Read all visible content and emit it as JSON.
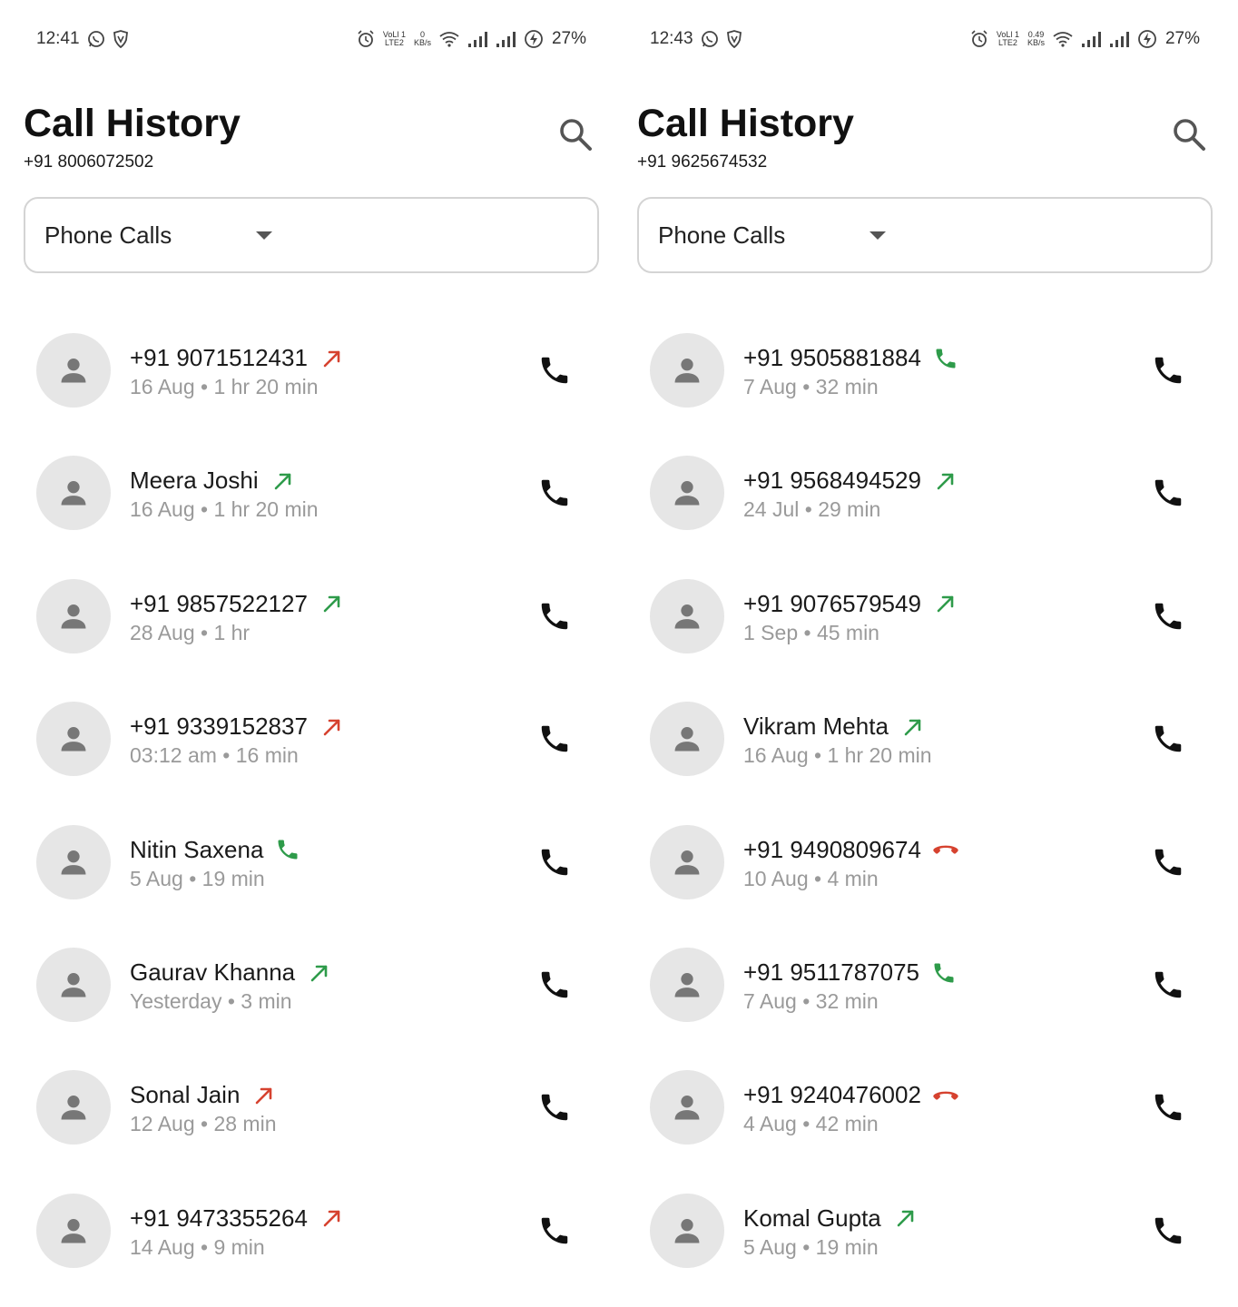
{
  "screens": [
    {
      "status_bar": {
        "time": "12:41",
        "net_speed_value": "0",
        "net_speed_unit": "KB/s",
        "volte_top": "VoLl 1",
        "volte_bottom": "LTE2",
        "battery": "27%"
      },
      "header": {
        "title": "Call History",
        "subtitle": "+91 8006072502"
      },
      "filter": {
        "selected": "Phone Calls"
      },
      "calls": [
        {
          "name": "+91 9071512431",
          "meta": "16 Aug • 1 hr 20 min",
          "type": "outgoing-red"
        },
        {
          "name": "Meera Joshi",
          "meta": "16 Aug • 1 hr 20 min",
          "type": "outgoing-green"
        },
        {
          "name": "+91 9857522127",
          "meta": "28 Aug • 1 hr",
          "type": "outgoing-green"
        },
        {
          "name": "+91 9339152837",
          "meta": "03:12 am • 16 min",
          "type": "outgoing-red"
        },
        {
          "name": "Nitin Saxena",
          "meta": "5 Aug • 19 min",
          "type": "incoming-green"
        },
        {
          "name": "Gaurav Khanna",
          "meta": "Yesterday • 3 min",
          "type": "outgoing-green"
        },
        {
          "name": "Sonal Jain",
          "meta": "12 Aug • 28 min",
          "type": "outgoing-red"
        },
        {
          "name": "+91 9473355264",
          "meta": "14 Aug • 9 min",
          "type": "outgoing-red"
        }
      ]
    },
    {
      "status_bar": {
        "time": "12:43",
        "net_speed_value": "0.49",
        "net_speed_unit": "KB/s",
        "volte_top": "VoLl 1",
        "volte_bottom": "LTE2",
        "battery": "27%"
      },
      "header": {
        "title": "Call History",
        "subtitle": "+91 9625674532"
      },
      "filter": {
        "selected": "Phone Calls"
      },
      "calls": [
        {
          "name": "+91 9505881884",
          "meta": "7 Aug • 32 min",
          "type": "incoming-green"
        },
        {
          "name": "+91 9568494529",
          "meta": "24 Jul • 29 min",
          "type": "outgoing-green"
        },
        {
          "name": "+91 9076579549",
          "meta": "1 Sep • 45 min",
          "type": "outgoing-green"
        },
        {
          "name": "Vikram Mehta",
          "meta": "16 Aug • 1 hr 20 min",
          "type": "outgoing-green"
        },
        {
          "name": "+91 9490809674",
          "meta": "10 Aug • 4 min",
          "type": "missed-red"
        },
        {
          "name": "+91 9511787075",
          "meta": "7 Aug • 32 min",
          "type": "incoming-green"
        },
        {
          "name": "+91 9240476002",
          "meta": "4 Aug • 42 min",
          "type": "missed-red"
        },
        {
          "name": "Komal Gupta",
          "meta": "5 Aug • 19 min",
          "type": "outgoing-green"
        }
      ]
    }
  ],
  "icons": {
    "search": "search-icon",
    "dropdown": "chevron-down-icon",
    "avatar": "person-icon",
    "call": "phone-icon",
    "outgoing": "arrow-up-right-icon",
    "incoming": "phone-icon",
    "missed": "phone-hangup-icon"
  },
  "colors": {
    "green": "#2e9b4a",
    "red": "#d6422f",
    "avatar_bg": "#e6e6e6",
    "avatar_fg": "#777777",
    "meta_text": "#9a9a9a"
  }
}
